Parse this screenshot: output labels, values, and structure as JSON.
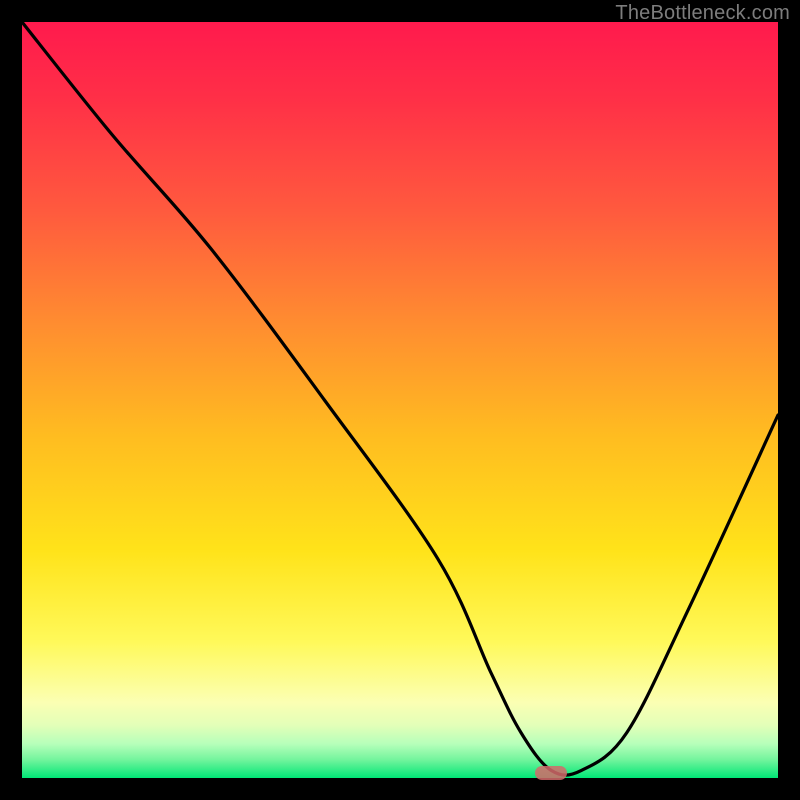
{
  "watermark": "TheBottleneck.com",
  "chart_data": {
    "type": "line",
    "title": "",
    "xlabel": "",
    "ylabel": "",
    "xlim": [
      0,
      100
    ],
    "ylim": [
      0,
      100
    ],
    "grid": false,
    "legend": false,
    "series": [
      {
        "name": "curve",
        "x": [
          0,
          12,
          25,
          40,
          55,
          62,
          66,
          70,
          74,
          80,
          88,
          100
        ],
        "values": [
          100,
          85,
          70,
          50,
          29,
          14,
          6,
          1,
          1,
          6,
          22,
          48
        ]
      }
    ],
    "marker": {
      "x": 70,
      "y": 0.6
    },
    "background_gradient": {
      "top": "#ff1a4d",
      "mid": "#ffd500",
      "bottom": "#00e676"
    }
  }
}
